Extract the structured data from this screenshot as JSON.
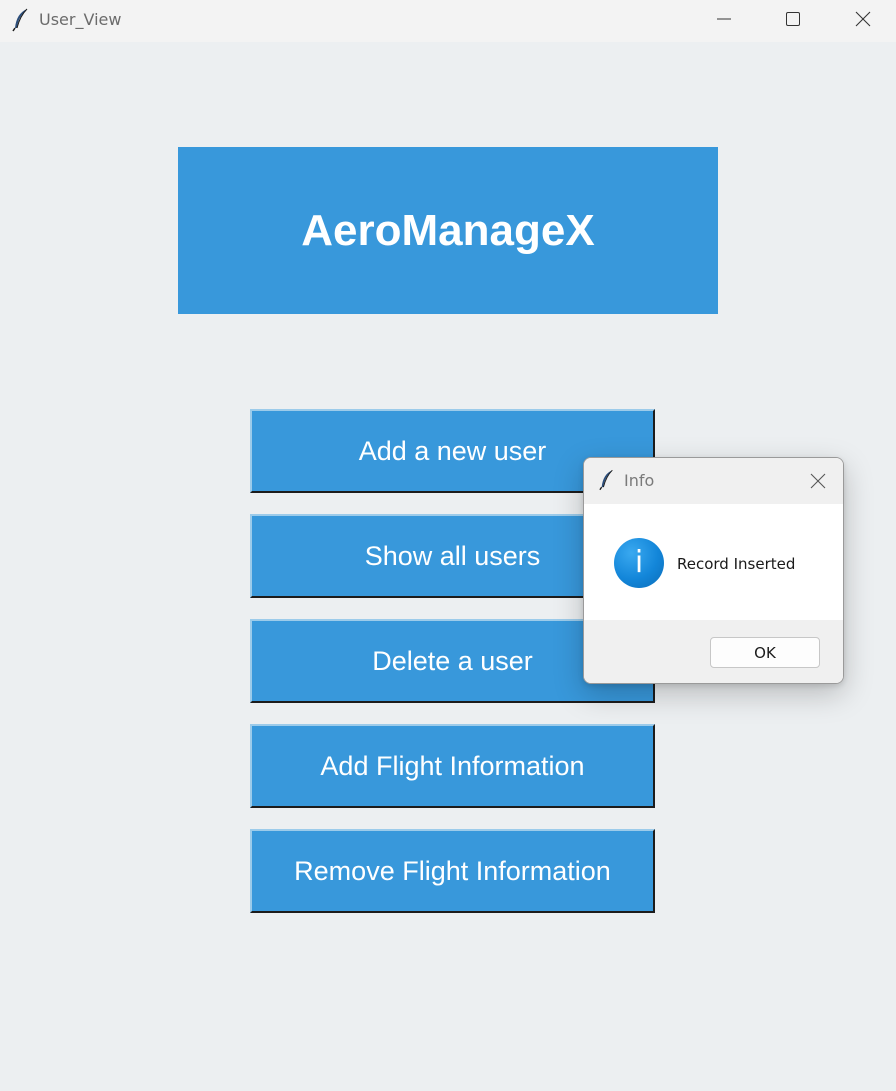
{
  "window": {
    "title": "User_View",
    "icon": "feather-icon"
  },
  "banner": {
    "title": "AeroManageX",
    "color": "#3898db"
  },
  "menu": {
    "buttons": [
      {
        "label": "Add a new user"
      },
      {
        "label": "Show all users"
      },
      {
        "label": "Delete a user"
      },
      {
        "label": "Add Flight Information"
      },
      {
        "label": "Remove Flight Information"
      }
    ]
  },
  "dialog": {
    "title": "Info",
    "icon": "info-icon",
    "message": "Record Inserted",
    "ok_label": "OK"
  }
}
